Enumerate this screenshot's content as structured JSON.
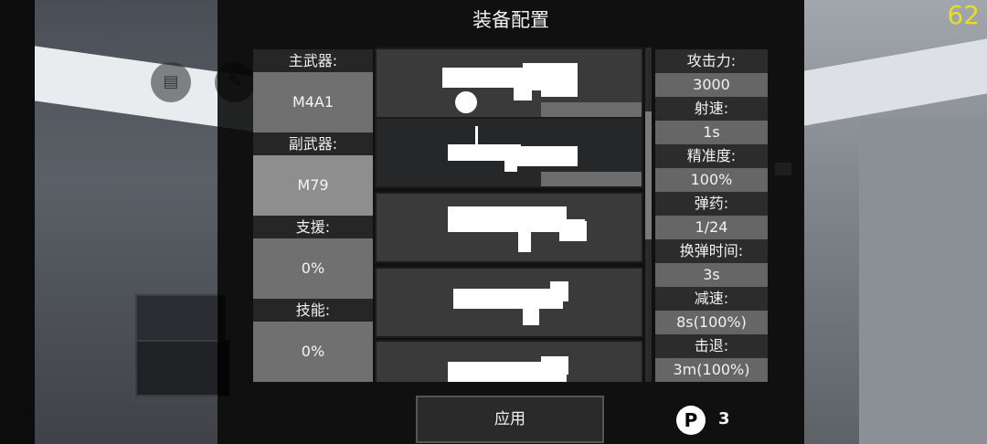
{
  "title": "装备配置",
  "fps": "62",
  "hud": {
    "chat_icon": "chat-bubble-icon",
    "edit_icon": "edit-icon",
    "extra_icon": "keyboard-icon"
  },
  "slots": [
    {
      "label": "主武器:",
      "value": "M4A1"
    },
    {
      "label": "副武器:",
      "value": "M79"
    },
    {
      "label": "支援:",
      "value": "0%"
    },
    {
      "label": "技能:",
      "value": "0%"
    }
  ],
  "weapons": [
    "rifle-with-scope-icon",
    "grenade-launcher-icon",
    "plasma-rifle-icon",
    "heavy-launcher-icon",
    "shotgun-icon"
  ],
  "stats": [
    {
      "label": "攻击力:",
      "value": "3000"
    },
    {
      "label": "射速:",
      "value": "1s"
    },
    {
      "label": "精准度:",
      "value": "100%"
    },
    {
      "label": "弹药:",
      "value": "1/24"
    },
    {
      "label": "换弹时间:",
      "value": "3s"
    },
    {
      "label": "减速:",
      "value": "8s(100%)"
    },
    {
      "label": "击退:",
      "value": "3m(100%)"
    }
  ],
  "apply_label": "应用",
  "points_icon": "P",
  "points": "3",
  "colors": {
    "fps": "#e6df27",
    "panel": "#000000"
  }
}
